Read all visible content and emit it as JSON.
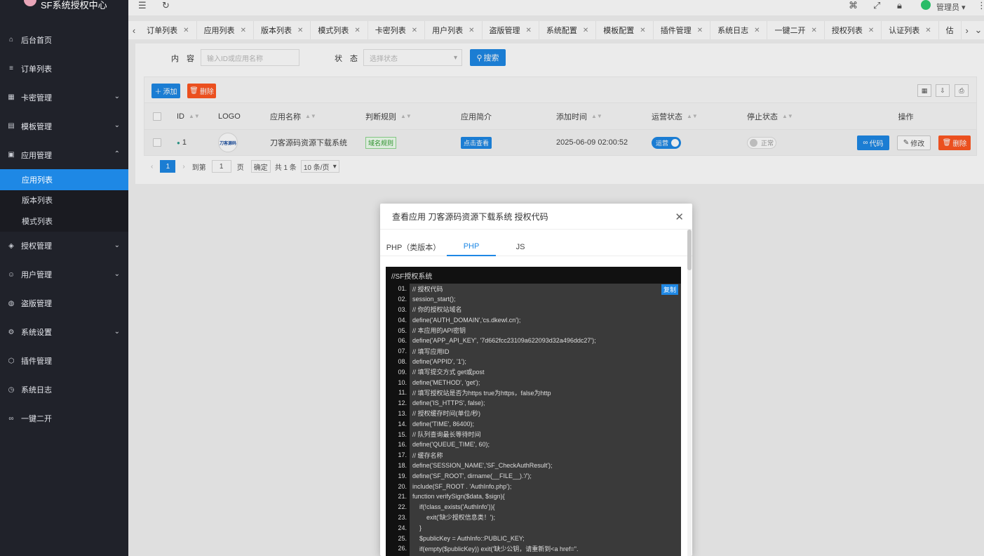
{
  "app": {
    "title": "SF系统授权中心"
  },
  "sidebar": {
    "items": [
      {
        "label": "后台首页",
        "icon": "home-icon",
        "glyph": "⌂"
      },
      {
        "label": "订单列表",
        "icon": "list-icon",
        "glyph": "≡"
      },
      {
        "label": "卡密管理",
        "icon": "grid-icon",
        "glyph": "▦",
        "chevron": "⌄"
      },
      {
        "label": "模板管理",
        "icon": "template-icon",
        "glyph": "▤",
        "chevron": "⌄"
      },
      {
        "label": "应用管理",
        "icon": "app-icon",
        "glyph": "▣",
        "chevron": "⌃"
      }
    ],
    "sub": [
      "应用列表",
      "版本列表",
      "模式列表"
    ],
    "items2": [
      {
        "label": "授权管理",
        "icon": "shield-icon",
        "glyph": "◈",
        "chevron": "⌄"
      },
      {
        "label": "用户管理",
        "icon": "user-icon",
        "glyph": "☺",
        "chevron": "⌄"
      },
      {
        "label": "盗版管理",
        "icon": "globe-icon",
        "glyph": "◍"
      },
      {
        "label": "系统设置",
        "icon": "gear-icon",
        "glyph": "⚙",
        "chevron": "⌄"
      },
      {
        "label": "插件管理",
        "icon": "plugin-icon",
        "glyph": "⬡"
      },
      {
        "label": "系统日志",
        "icon": "clock-icon",
        "glyph": "◷"
      },
      {
        "label": "一键二开",
        "icon": "link-icon",
        "glyph": "∞"
      }
    ]
  },
  "topbar": {
    "user": "管理员"
  },
  "tabs": [
    "订单列表",
    "应用列表",
    "版本列表",
    "模式列表",
    "卡密列表",
    "用户列表",
    "盗版管理",
    "系统配置",
    "模板配置",
    "插件管理",
    "系统日志",
    "一键二开",
    "授权列表",
    "认证列表",
    "估"
  ],
  "search": {
    "content_label": "内　容",
    "content_placeholder": "输入ID或应用名称",
    "status_label": "状　态",
    "status_placeholder": "选择状态",
    "button": "搜索"
  },
  "toolbar": {
    "add": "添加",
    "delete": "删除"
  },
  "table": {
    "headers": [
      "ID",
      "LOGO",
      "应用名称",
      "判断规则",
      "应用简介",
      "添加时间",
      "运营状态",
      "停止状态",
      "操作"
    ],
    "row": {
      "id": "1",
      "logo_text": "刀客源码",
      "name": "刀客源码资源下载系统",
      "rule": "域名规则",
      "intro": "点击查看",
      "time": "2025-06-09 02:00:52",
      "run_status": "运营",
      "stop_status": "正常",
      "ops": [
        "代码",
        "修改",
        "删除"
      ]
    }
  },
  "pager": {
    "current": "1",
    "goto": "到第",
    "page_value": "1",
    "page_unit": "页",
    "confirm": "确定",
    "total": "共 1 条",
    "per_page": "10 条/页"
  },
  "modal": {
    "title": "查看应用 刀客源码资源下载系统 授权代码",
    "tabs": [
      "PHP（类版本）",
      "PHP",
      "JS"
    ],
    "active_tab": "PHP",
    "code_header": "//SF授权系统",
    "copy": "复制",
    "lines": [
      "// 授权代码",
      "session_start();",
      "// 你的授权站域名",
      "define('AUTH_DOMAIN','cs.dkewl.cn');",
      "// 本应用的API密钥",
      "define('APP_API_KEY', '7d662fcc23109a622093d32a496ddc27');",
      "// 填写应用ID",
      "define('APPID', '1');",
      "// 填写提交方式 get或post",
      "define('METHOD', 'get');",
      "// 填写授权站是否为https true为https，false为http",
      "define('IS_HTTPS', false);",
      "// 授权缓存时间(单位/秒)",
      "define('TIME', 86400);",
      "// 队列查询最长等待时间",
      "define('QUEUE_TIME', 60);",
      "// 缓存名称",
      "define('SESSION_NAME','SF_CheckAuthResult');",
      "define('SF_ROOT', dirname(__FILE__).'/');",
      "include(SF_ROOT . 'AuthInfo.php');",
      "function verifySign($data, $sign){",
      "    if(!class_exists('AuthInfo')){",
      "        exit('缺少授权信息类！');",
      "    }",
      "    $publicKey = AuthInfo::PUBLIC_KEY;",
      "    if(empty($publicKey)) exit('缺少公钥，请重新到<a href=\"."
    ],
    "line_numbers": [
      "01.",
      "02.",
      "03.",
      "04.",
      "05.",
      "06.",
      "07.",
      "08.",
      "09.",
      "10.",
      "11.",
      "12.",
      "13.",
      "14.",
      "15.",
      "16.",
      "17.",
      "18.",
      "19.",
      "20.",
      "21.",
      "22.",
      "23.",
      "24.",
      "25.",
      "26."
    ]
  }
}
